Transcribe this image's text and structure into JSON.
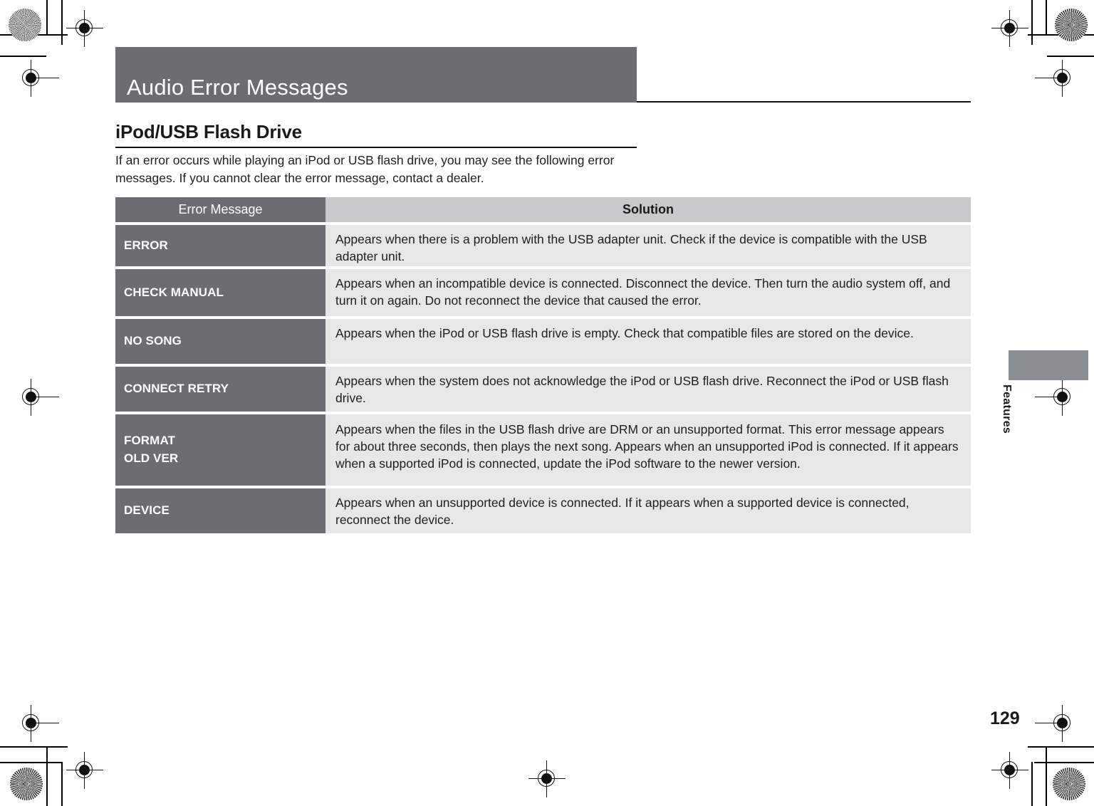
{
  "page": {
    "title": "Audio Error Messages",
    "subtitle": "iPod/USB Flash Drive",
    "intro": "If an error occurs while playing an iPod or USB flash drive, you may see the following error messages. If you cannot clear the error message, contact a dealer.",
    "page_number": "129",
    "side_tab_label": "Features",
    "colors": {
      "band_gray": "#6b6d70",
      "header_light_gray": "#c8c9ca",
      "cell_gray": "#e6e7e7",
      "tab_gray": "#8a8d92",
      "text": "#1a1a1a"
    }
  },
  "table": {
    "headers": {
      "message": "Error Message",
      "solution": "Solution"
    },
    "rows": [
      {
        "message": "ERROR",
        "message_line2": "",
        "solution": "Appears when there is a problem with the USB adapter unit. Check if the device is compatible with the USB adapter unit."
      },
      {
        "message": "CHECK MANUAL",
        "message_line2": "",
        "solution": "Appears when an incompatible device is connected. Disconnect the device. Then turn the audio system off, and turn it on again. Do not reconnect the device that caused the error."
      },
      {
        "message": "NO SONG",
        "message_line2": "",
        "solution": "Appears when the iPod or USB flash drive is empty. Check that compatible files are stored on the device."
      },
      {
        "message": "CONNECT RETRY",
        "message_line2": "",
        "solution": "Appears when the system does not acknowledge the iPod or USB flash drive. Reconnect the iPod or USB flash drive."
      },
      {
        "message": "FORMAT",
        "message_line2": "OLD VER",
        "solution": "Appears when the files in the USB flash drive are DRM or an unsupported format. This error message appears for about three seconds, then plays the next song.",
        "solution_line2": "Appears when an unsupported iPod is connected. If it appears when a supported iPod is connected, update the iPod software to the newer version."
      },
      {
        "message": "DEVICE",
        "message_line2": "",
        "solution": "Appears when an unsupported device is connected. If it appears when a supported device is connected, reconnect the device."
      }
    ]
  }
}
